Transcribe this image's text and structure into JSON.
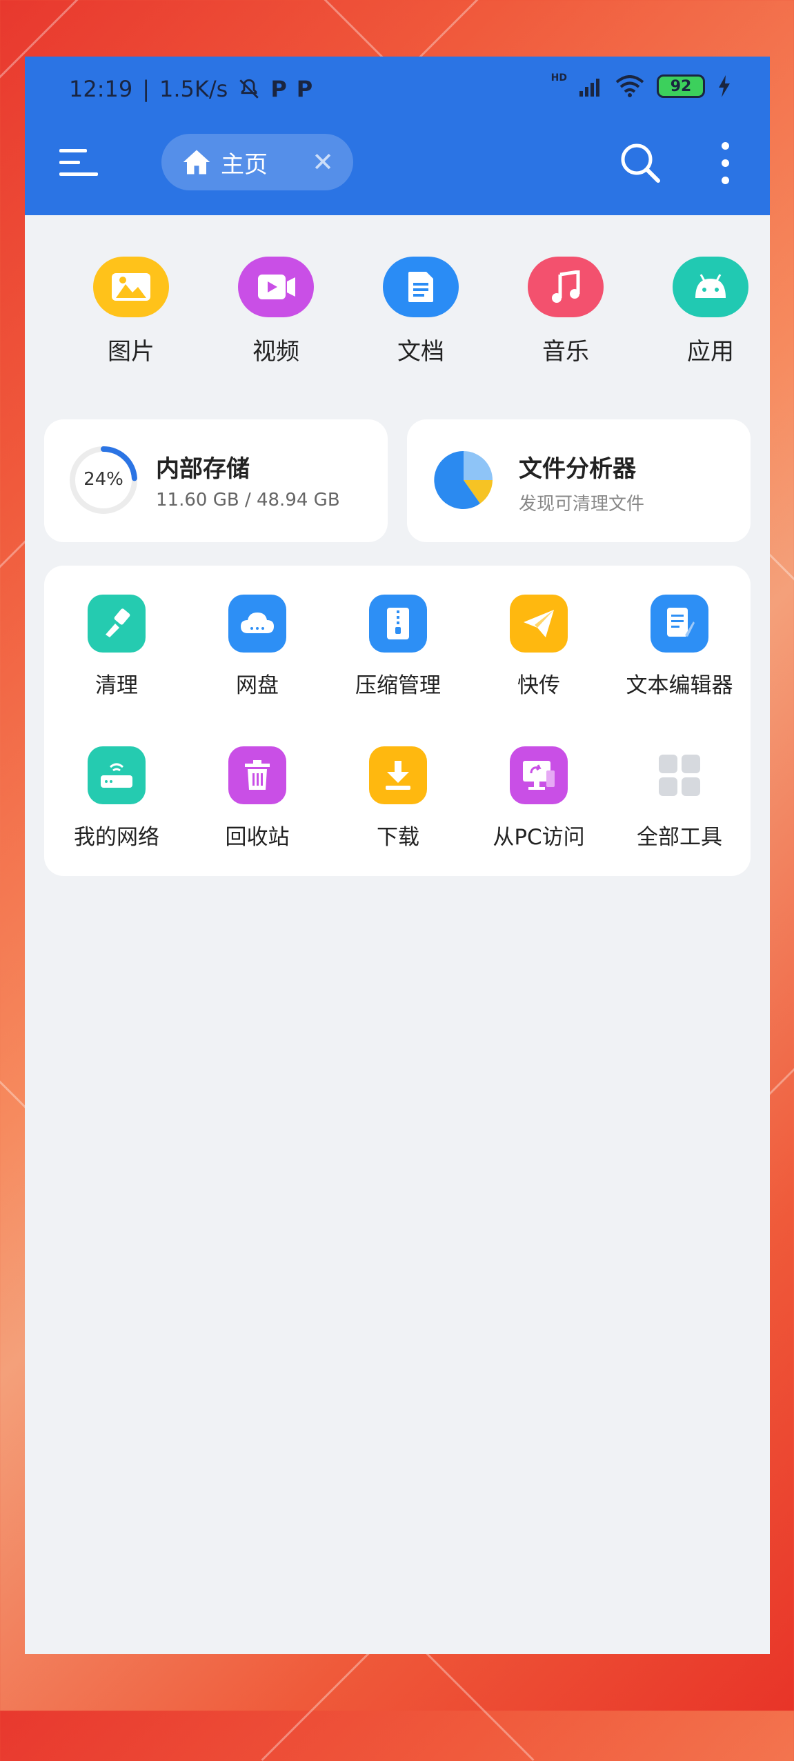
{
  "status": {
    "time": "12:19",
    "speed": "1.5K/s",
    "network": "HD",
    "battery": "92"
  },
  "header": {
    "tab_label": "主页"
  },
  "categories": [
    {
      "label": "图片",
      "icon": "image-icon",
      "color": "#ffc21a"
    },
    {
      "label": "视频",
      "icon": "video-icon",
      "color": "#c94fe6"
    },
    {
      "label": "文档",
      "icon": "document-icon",
      "color": "#2a8cf5"
    },
    {
      "label": "音乐",
      "icon": "music-icon",
      "color": "#f3516e"
    },
    {
      "label": "应用",
      "icon": "android-icon",
      "color": "#21c9b2"
    }
  ],
  "storage": {
    "title": "内部存储",
    "percent": "24%",
    "percent_value": 0.24,
    "usage": "11.60 GB / 48.94 GB"
  },
  "analyzer": {
    "title": "文件分析器",
    "subtitle": "发现可清理文件"
  },
  "tools": [
    {
      "label": "清理",
      "icon": "clean-brush-icon",
      "color": "#25cbb0"
    },
    {
      "label": "网盘",
      "icon": "cloud-drive-icon",
      "color": "#2d8ff5"
    },
    {
      "label": "压缩管理",
      "icon": "zip-icon",
      "color": "#2d8ff5"
    },
    {
      "label": "快传",
      "icon": "paper-plane-icon",
      "color": "#ffb80f"
    },
    {
      "label": "文本编辑器",
      "icon": "text-edit-icon",
      "color": "#2d8ff5"
    },
    {
      "label": "我的网络",
      "icon": "router-icon",
      "color": "#25cbb0"
    },
    {
      "label": "回收站",
      "icon": "trash-icon",
      "color": "#c94fe6"
    },
    {
      "label": "下载",
      "icon": "download-icon",
      "color": "#ffb80f"
    },
    {
      "label": "从PC访问",
      "icon": "pc-access-icon",
      "color": "#c94fe6"
    },
    {
      "label": "全部工具",
      "icon": "all-tools-grid-icon",
      "color": "#d6d9de"
    }
  ]
}
